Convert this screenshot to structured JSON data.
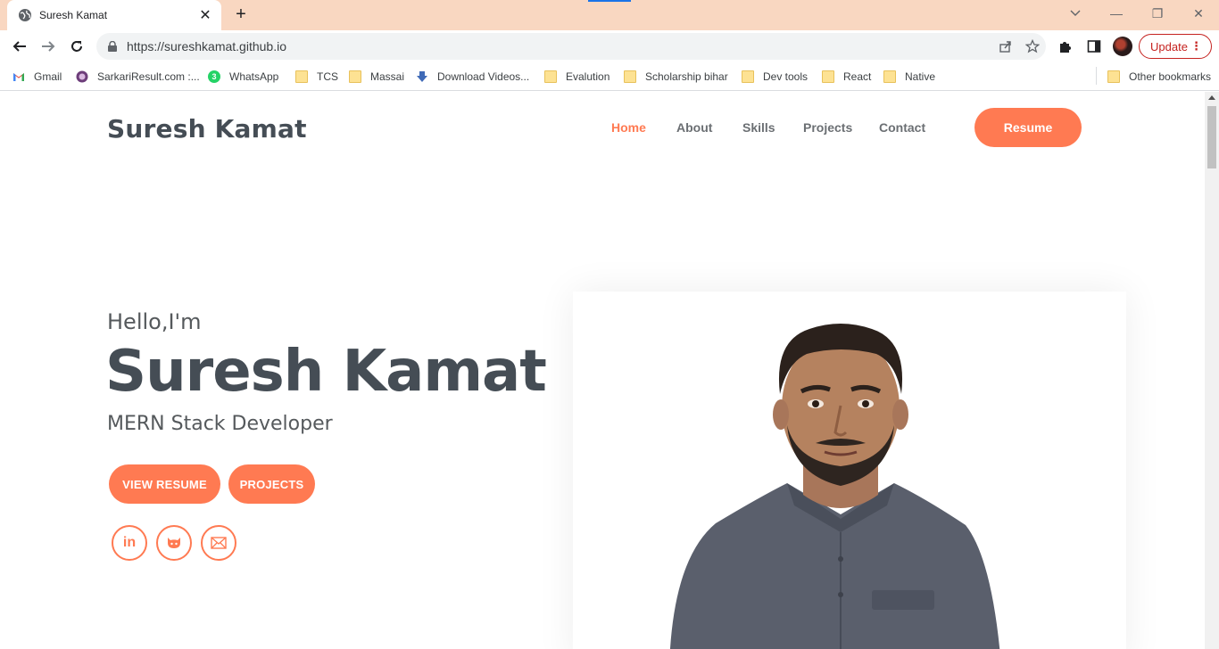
{
  "browser": {
    "tab": {
      "title": "Suresh Kamat",
      "close": "✕"
    },
    "new_tab": "+",
    "window_controls": {
      "minimize": "—",
      "restore": "❐",
      "close": "✕"
    },
    "address": {
      "url": "https://sureshkamat.github.io"
    },
    "update_button": {
      "label": "Update",
      "menu": "⋮"
    },
    "bookmarks": [
      {
        "label": "Gmail",
        "icon": "gmail-icon"
      },
      {
        "label": "SarkariResult.com :...",
        "icon": "sarkari-icon"
      },
      {
        "label": "WhatsApp",
        "icon": "whatsapp-icon",
        "badge": "3"
      },
      {
        "label": "TCS",
        "icon": "folder-icon"
      },
      {
        "label": "Massai",
        "icon": "folder-icon"
      },
      {
        "label": "Download Videos...",
        "icon": "download-icon"
      },
      {
        "label": "Evalution",
        "icon": "folder-icon"
      },
      {
        "label": "Scholarship bihar",
        "icon": "folder-icon"
      },
      {
        "label": "Dev tools",
        "icon": "folder-icon"
      },
      {
        "label": "React",
        "icon": "folder-icon"
      },
      {
        "label": "Native",
        "icon": "folder-icon"
      }
    ],
    "other_bookmarks": "Other bookmarks"
  },
  "site": {
    "brand": "Suresh Kamat",
    "nav": [
      "Home",
      "About",
      "Skills",
      "Projects",
      "Contact"
    ],
    "active_nav": "Home",
    "resume_button": "Resume",
    "hero": {
      "greeting": "Hello,I'm",
      "name": "Suresh Kamat",
      "role": "MERN Stack Developer",
      "buttons": [
        "VIEW RESUME",
        "PROJECTS"
      ]
    },
    "social": [
      {
        "icon": "linkedin-icon",
        "glyph": "in"
      },
      {
        "icon": "github-icon"
      },
      {
        "icon": "mail-icon"
      }
    ]
  },
  "colors": {
    "accent": "#ff7a52",
    "heading": "#454d55",
    "titlebar": "#f9d7c1"
  }
}
